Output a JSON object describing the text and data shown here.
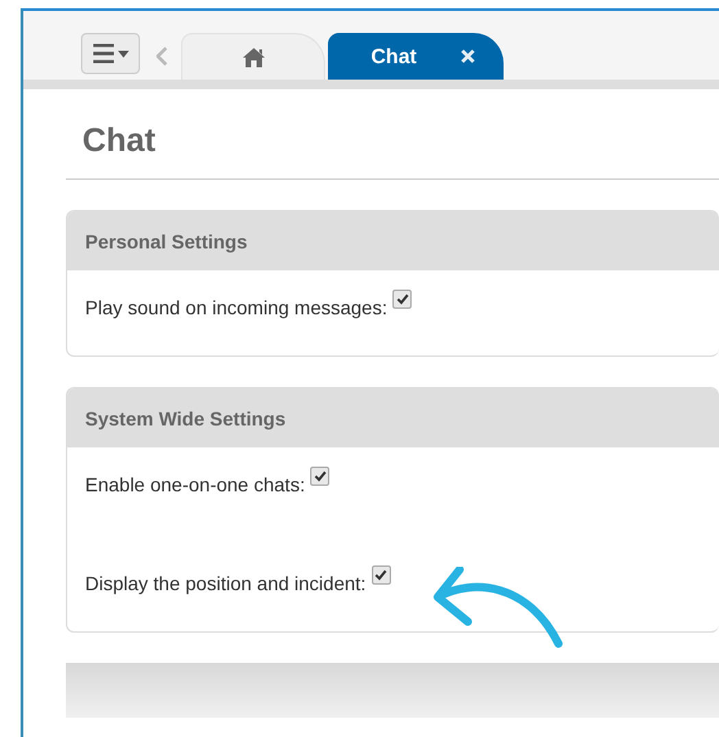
{
  "tabs": [
    {
      "kind": "home",
      "selected": false
    },
    {
      "kind": "text",
      "label": "Chat",
      "selected": true,
      "closable": true
    }
  ],
  "page_title": "Chat",
  "panels": [
    {
      "title": "Personal Settings",
      "settings": [
        {
          "label": "Play sound on incoming messages:",
          "checked": true
        }
      ]
    },
    {
      "title": "System Wide Settings",
      "settings": [
        {
          "label": "Enable one-on-one chats:",
          "checked": true
        },
        {
          "label": "Display the position and incident:",
          "checked": true,
          "highlighted": true
        }
      ]
    }
  ]
}
